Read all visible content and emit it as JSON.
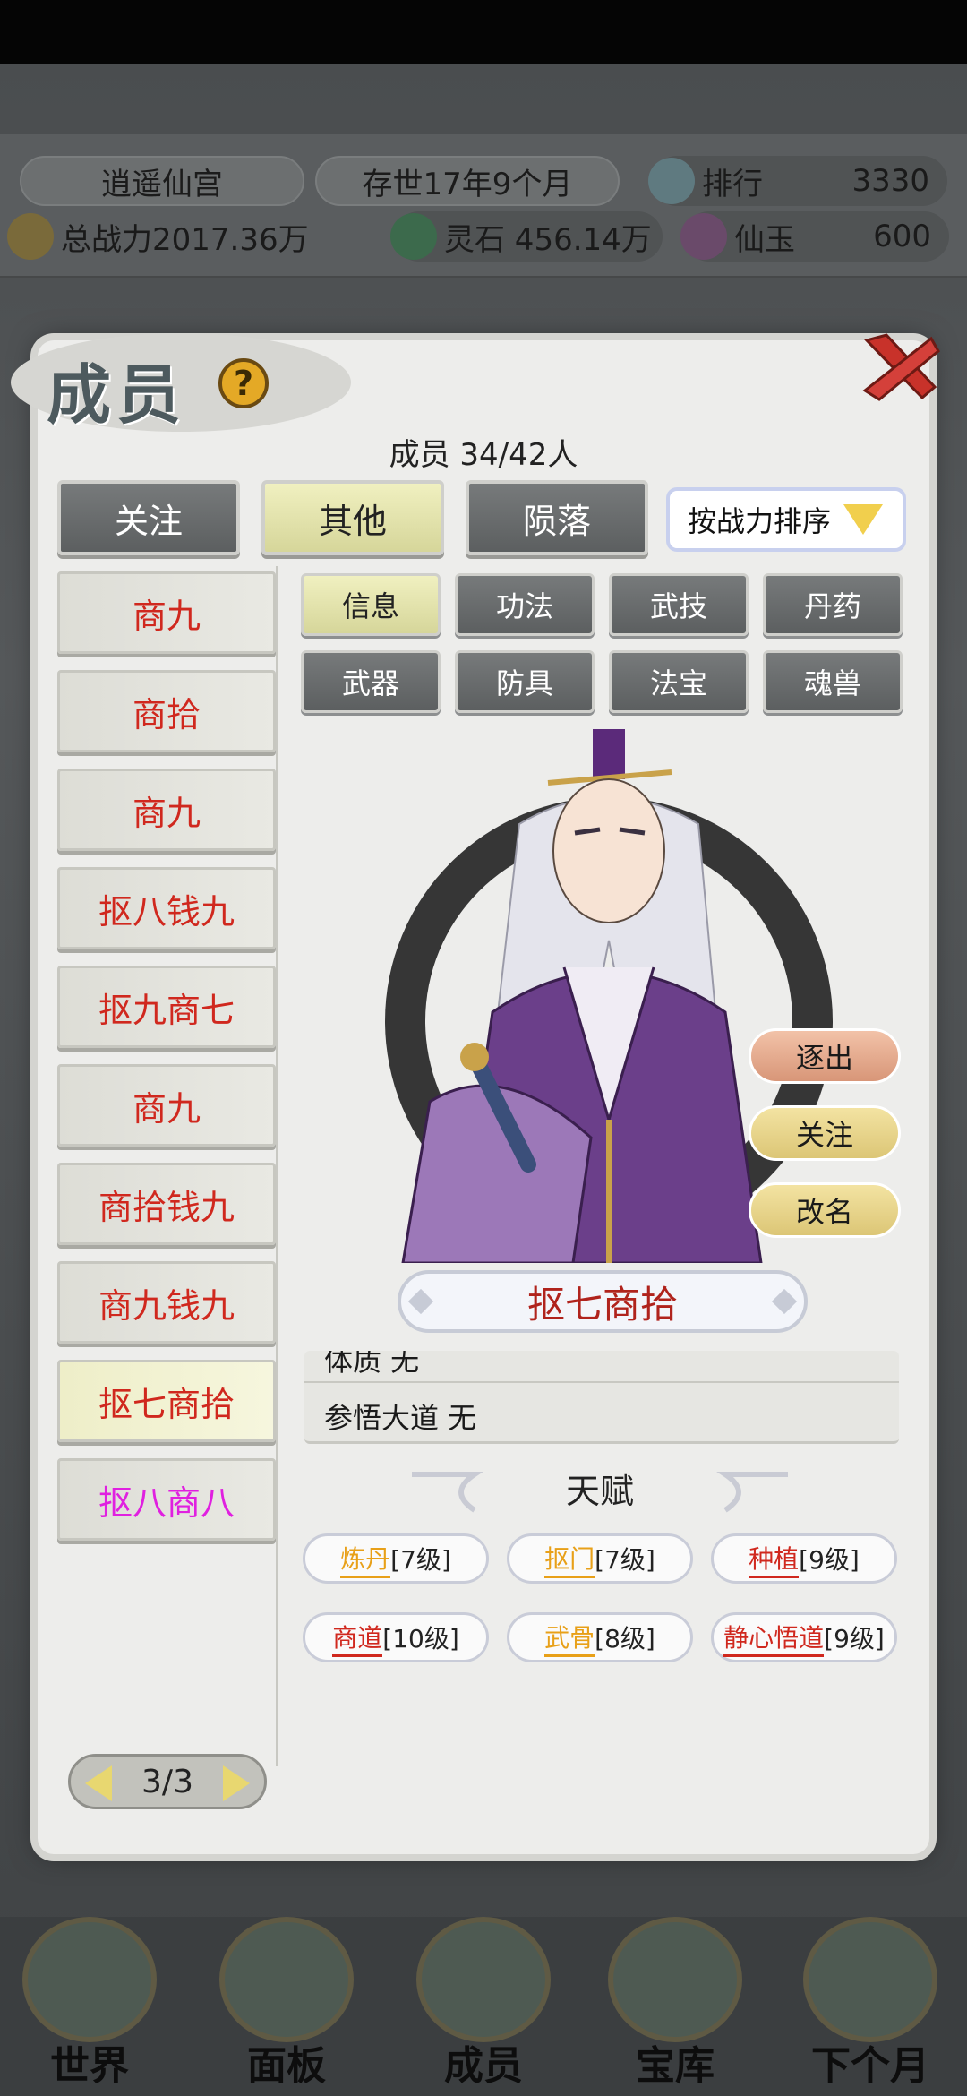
{
  "header": {
    "sect_name": "逍遥仙宫",
    "era": "存世17年9个月",
    "rank_label": "排行",
    "rank_value": "3330",
    "power_label": "总战力2017.36万",
    "spirit_stone": "灵石 456.14万",
    "jade_label": "仙玉",
    "jade_value": "600"
  },
  "modal": {
    "title": "成员",
    "help_icon": "?",
    "member_count": "成员  34/42人",
    "tabs": [
      {
        "label": "关注",
        "active": false
      },
      {
        "label": "其他",
        "active": true
      },
      {
        "label": "陨落",
        "active": false
      }
    ],
    "sort_label": "按战力排序",
    "members": [
      {
        "name": "商九",
        "color": "#d0281e",
        "selected": false
      },
      {
        "name": "商拾",
        "color": "#d0281e",
        "selected": false
      },
      {
        "name": "商九",
        "color": "#d0281e",
        "selected": false
      },
      {
        "name": "抠八钱九",
        "color": "#d0281e",
        "selected": false
      },
      {
        "name": "抠九商七",
        "color": "#d0281e",
        "selected": false
      },
      {
        "name": "商九",
        "color": "#d0281e",
        "selected": false
      },
      {
        "name": "商拾钱九",
        "color": "#d0281e",
        "selected": false
      },
      {
        "name": "商九钱九",
        "color": "#d0281e",
        "selected": false
      },
      {
        "name": "抠七商拾",
        "color": "#d0281e",
        "selected": true
      },
      {
        "name": "抠八商八",
        "color": "#e020e0",
        "selected": false
      }
    ],
    "subtabs": [
      {
        "label": "信息",
        "active": true
      },
      {
        "label": "功法",
        "active": false
      },
      {
        "label": "武技",
        "active": false
      },
      {
        "label": "丹药",
        "active": false
      },
      {
        "label": "武器",
        "active": false
      },
      {
        "label": "防具",
        "active": false
      },
      {
        "label": "法宝",
        "active": false
      },
      {
        "label": "魂兽",
        "active": false
      }
    ],
    "actions": {
      "expel": "逐出",
      "follow": "关注",
      "rename": "改名"
    },
    "character_name": "抠七商拾",
    "info_rows": {
      "constitution": "体质 无",
      "comprehend": "参悟大道 无"
    },
    "talent_header": "天赋",
    "talents": [
      {
        "name": "炼丹",
        "level": "[7级]",
        "color": "#e8a018"
      },
      {
        "name": "抠门",
        "level": "[7级]",
        "color": "#e8a018"
      },
      {
        "name": "种植",
        "level": "[9级]",
        "color": "#d0281e"
      },
      {
        "name": "商道",
        "level": "[10级]",
        "color": "#d0281e"
      },
      {
        "name": "武骨",
        "level": "[8级]",
        "color": "#e8a018"
      },
      {
        "name": "静心悟道",
        "level": "[9级]",
        "color": "#d0281e"
      }
    ],
    "pager": "3/3"
  },
  "bottom_nav": [
    "世界",
    "面板",
    "成员",
    "宝库",
    "下个月"
  ]
}
